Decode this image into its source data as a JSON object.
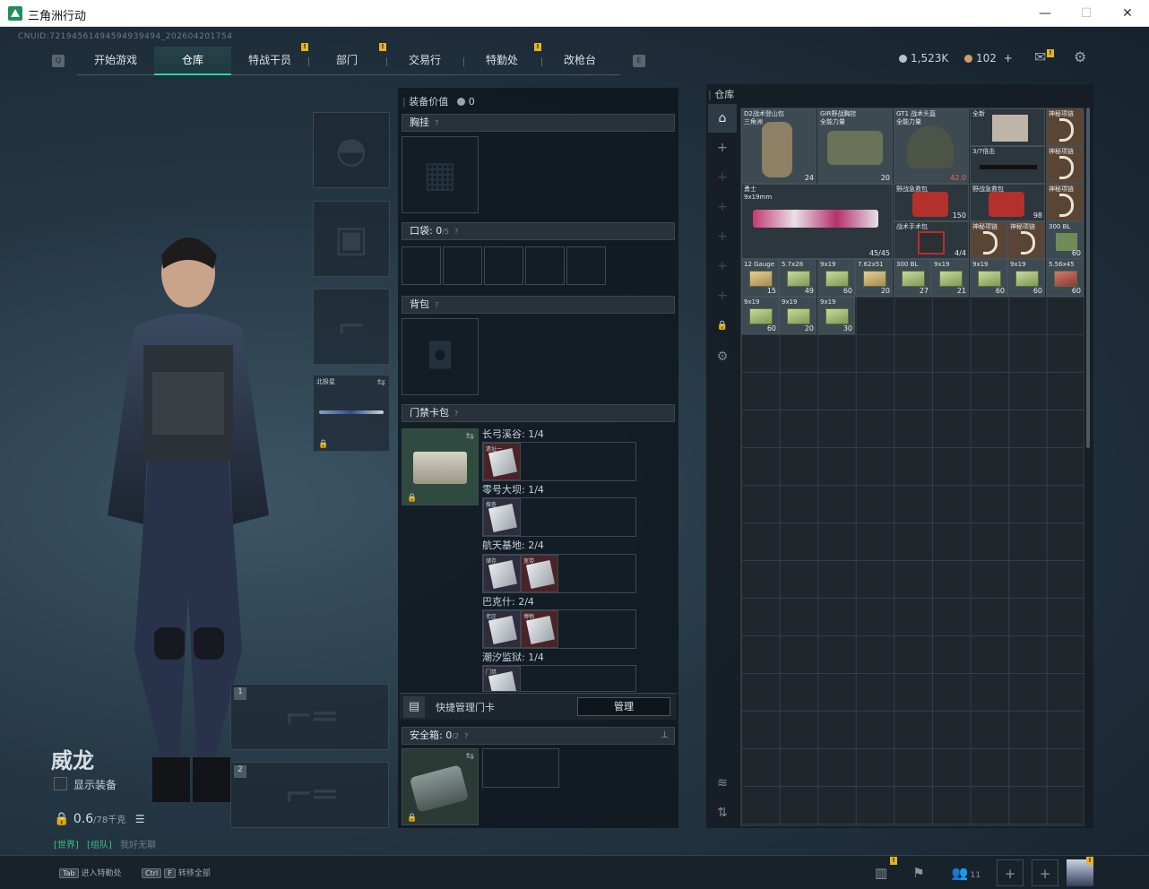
{
  "window": {
    "title": "三角洲行动",
    "min": "—",
    "max": "☐",
    "close": "✕"
  },
  "cnuid": "CNUID:7219456149459493949​4_202604201754",
  "nav": {
    "items": [
      {
        "label": "开始游戏",
        "badge": ""
      },
      {
        "label": "仓库",
        "badge": ""
      },
      {
        "label": "特战干员",
        "badge": "!"
      },
      {
        "label": "部门",
        "badge": "!"
      },
      {
        "label": "交易行",
        "badge": ""
      },
      {
        "label": "特勤处",
        "badge": "!"
      },
      {
        "label": "改枪台",
        "badge": ""
      }
    ],
    "left_key": "Q",
    "right_key": "E"
  },
  "currency": {
    "coins": "1,523K",
    "tickets": "102",
    "plus": "+"
  },
  "icons": {
    "mail": "mail-icon",
    "settings": "gear-icon"
  },
  "character": {
    "name": "威龙",
    "show_gear": "显示装备",
    "weight": "0.6",
    "weight_max": "/78千克",
    "tags": [
      "[世界]",
      "[组队]",
      "我好无聊"
    ]
  },
  "equipment": {
    "melee_label": "北极星",
    "weapon_slots": [
      "1",
      "2"
    ]
  },
  "loadout": {
    "value_label": "装备价值",
    "value": "0",
    "chest_rig": "胸挂",
    "pocket_label": "口袋:",
    "pocket_count": "0",
    "pocket_max": "/5",
    "backpack": "背包",
    "keycard_wallet": "门禁卡包",
    "keycard_maps": [
      {
        "name": "长弓溪谷: 1/4",
        "cards": [
          {
            "label": "遗址一",
            "color": "red"
          }
        ]
      },
      {
        "name": "零号大坝: 1/4",
        "cards": [
          {
            "label": "搜查",
            "color": "blue"
          }
        ]
      },
      {
        "name": "航天基地: 2/4",
        "cards": [
          {
            "label": "储存",
            "color": "blue"
          },
          {
            "label": "宽带",
            "color": "red"
          }
        ]
      },
      {
        "name": "巴克什: 2/4",
        "cards": [
          {
            "label": "老区",
            "color": "blue"
          },
          {
            "label": "博物",
            "color": "red"
          }
        ]
      },
      {
        "name": "潮汐监狱: 1/4",
        "cards": [
          {
            "label": "门禁",
            "color": "blue"
          }
        ]
      }
    ],
    "quick_manage": "快捷管理门卡",
    "manage_button": "管理",
    "safe_box_label": "安全箱:",
    "safe_box_count": "0",
    "safe_box_max": "/2"
  },
  "stash": {
    "title": "仓库",
    "items": [
      {
        "name": "D2战术登山包\n三角洲",
        "count": "24",
        "color": "gray"
      },
      {
        "name": "GIR野战胸挂\n全能力量",
        "count": "20",
        "color": "gray"
      },
      {
        "name": "GT1 战术头盔\n全能力量",
        "count": "42.0",
        "color": "gray"
      },
      {
        "name": "全新",
        "count": "",
        "color": "dgray"
      },
      {
        "name": "3/7倍击",
        "count": "",
        "color": "dgray"
      },
      {
        "name": "神秘项链",
        "count": "",
        "color": "brown"
      },
      {
        "name": "勇士\n9x19mm",
        "count": "45/45",
        "color": "dgray"
      },
      {
        "name": "野战急救包",
        "count": "150",
        "color": "dgray"
      },
      {
        "name": "野战急救包",
        "count": "98",
        "color": "dgray"
      },
      {
        "name": "战术手术包",
        "count": "4/4",
        "color": "dgray"
      },
      {
        "name": "神秘项链",
        "count": "",
        "color": "brown"
      },
      {
        "name": "神秘项链",
        "count": "",
        "color": "brown"
      },
      {
        "name": "神秘项链",
        "count": "",
        "color": "brown"
      },
      {
        "name": "300 BL",
        "count": "60",
        "color": "gray"
      }
    ],
    "ammo": [
      {
        "name": "12 Gauge",
        "count": "15",
        "tone": "tan"
      },
      {
        "name": "5.7x28",
        "count": "49",
        "tone": "green"
      },
      {
        "name": "9x19",
        "count": "60",
        "tone": "green"
      },
      {
        "name": "7.62x51",
        "count": "20",
        "tone": "tan"
      },
      {
        "name": "300 BL",
        "count": "27",
        "tone": "green"
      },
      {
        "name": "9x19",
        "count": "21",
        "tone": "green"
      },
      {
        "name": "9x19",
        "count": "60",
        "tone": "green"
      },
      {
        "name": "9x19",
        "count": "60",
        "tone": "green"
      },
      {
        "name": "5.56x45",
        "count": "60",
        "tone": "red"
      },
      {
        "name": "9x19",
        "count": "60",
        "tone": "green"
      },
      {
        "name": "9x19",
        "count": "20",
        "tone": "green"
      },
      {
        "name": "9x19",
        "count": "30",
        "tone": "green"
      }
    ]
  },
  "bottom": {
    "hint1_key": "Tab",
    "hint1": "进入特勤处",
    "hint2_keys": [
      "Ctrl",
      "F"
    ],
    "hint2": "转移全部",
    "friends": "11"
  },
  "colors": {
    "accent": "#2bd4a0",
    "badge": "#e6b422"
  }
}
